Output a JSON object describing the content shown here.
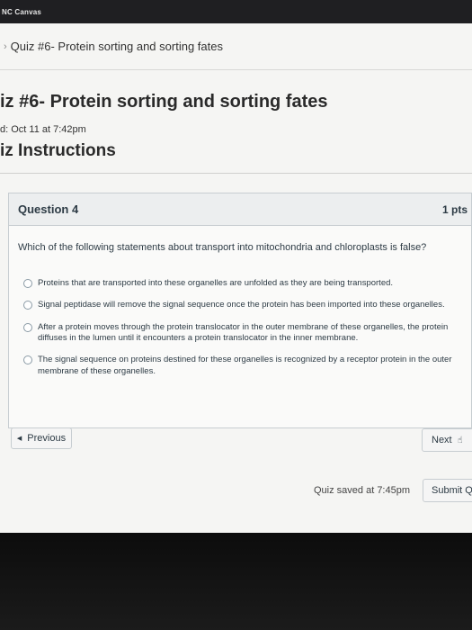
{
  "window": {
    "title": "NC Canvas"
  },
  "breadcrumb": {
    "label": "Quiz #6- Protein sorting and sorting fates"
  },
  "quiz": {
    "title": "iz #6- Protein sorting and sorting fates",
    "due": "d: Oct 11 at 7:42pm",
    "instructions_heading": "iz Instructions"
  },
  "question": {
    "number": "Question 4",
    "points": "1 pts",
    "text": "Which of the following statements about transport into mitochondria and chloroplasts is false?",
    "answers": [
      "Proteins that are transported into these organelles are unfolded as they are being transported.",
      "Signal peptidase will remove the signal sequence once the protein has been imported into these organelles.",
      "After a protein moves through the protein translocator in the outer membrane of these organelles, the protein diffuses in the lumen until it encounters a protein translocator in the inner membrane.",
      "The signal sequence on proteins destined for these organelles is recognized by a receptor protein in the outer membrane of these organelles."
    ]
  },
  "nav": {
    "previous_label": "Previous",
    "next_label": "Next"
  },
  "footer": {
    "saved_text": "Quiz saved at 7:45pm",
    "submit_label": "Submit Q"
  }
}
